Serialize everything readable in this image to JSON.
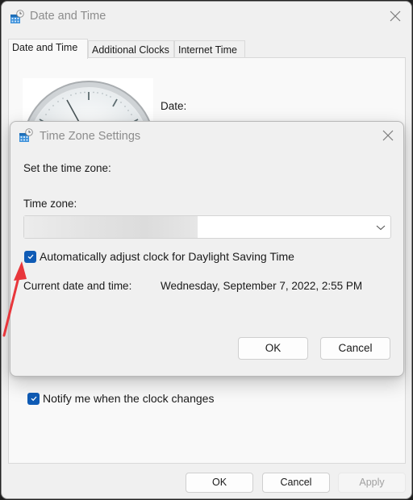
{
  "main_window": {
    "title": "Date and Time",
    "icon": "calendar-clock-icon",
    "tabs": [
      {
        "label": "Date and Time",
        "active": true
      },
      {
        "label": "Additional Clocks",
        "active": false
      },
      {
        "label": "Internet Time",
        "active": false
      }
    ],
    "date_label": "Date:",
    "notify_checkbox": {
      "label": "Notify me when the clock changes",
      "checked": true
    },
    "buttons": {
      "ok": "OK",
      "cancel": "Cancel",
      "apply": "Apply"
    }
  },
  "time_zone_dialog": {
    "title": "Time Zone Settings",
    "icon": "calendar-clock-icon",
    "set_label": "Set the time zone:",
    "time_zone_label": "Time zone:",
    "time_zone_value": "",
    "dst_checkbox": {
      "label": "Automatically adjust clock for Daylight Saving Time",
      "checked": true
    },
    "current_label": "Current date and time:",
    "current_value": "Wednesday, September 7, 2022, 2:55 PM",
    "buttons": {
      "ok": "OK",
      "cancel": "Cancel"
    }
  },
  "colors": {
    "accent": "#0f5bb5",
    "annotation_arrow": "#e8363b"
  }
}
